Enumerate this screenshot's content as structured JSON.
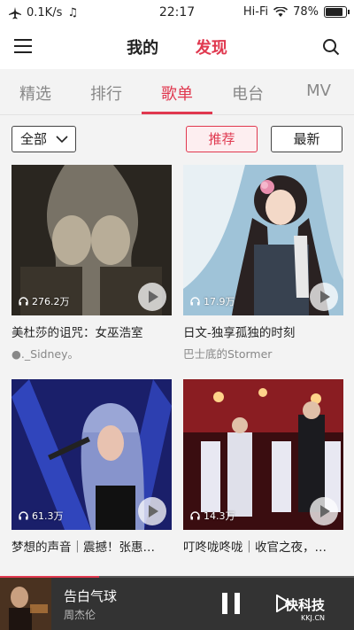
{
  "status": {
    "speed": "0.1K/s",
    "time": "22:17",
    "network": "Hi-Fi",
    "battery": "78%"
  },
  "header": {
    "tabs": [
      "我的",
      "发现"
    ],
    "active_tab": "发现"
  },
  "subtabs": {
    "items": [
      "精选",
      "排行",
      "歌单",
      "电台",
      "MV"
    ],
    "active": "歌单"
  },
  "filter": {
    "selected": "全部",
    "recommend_label": "推荐",
    "newest_label": "最新"
  },
  "playlists": [
    {
      "title": "美杜莎的诅咒：女巫浩室",
      "author": "●._Sidney。",
      "plays": "276.2万"
    },
    {
      "title": "日文-独享孤独的时刻",
      "author": "巴士底的Stormer",
      "plays": "17.9万"
    },
    {
      "title": "梦想的声音｜震撼！张惠…",
      "author": "",
      "plays": "61.3万"
    },
    {
      "title": "叮咚咙咚咙｜收官之夜，…",
      "author": "",
      "plays": "14.3万"
    }
  ],
  "player": {
    "song": "告白气球",
    "artist": "周杰伦",
    "progress": 0.28
  },
  "watermark": {
    "main": "快科技",
    "sub": "KKJ.CN"
  },
  "colors": {
    "accent": "#e0384f",
    "player_bg": "#333333"
  }
}
